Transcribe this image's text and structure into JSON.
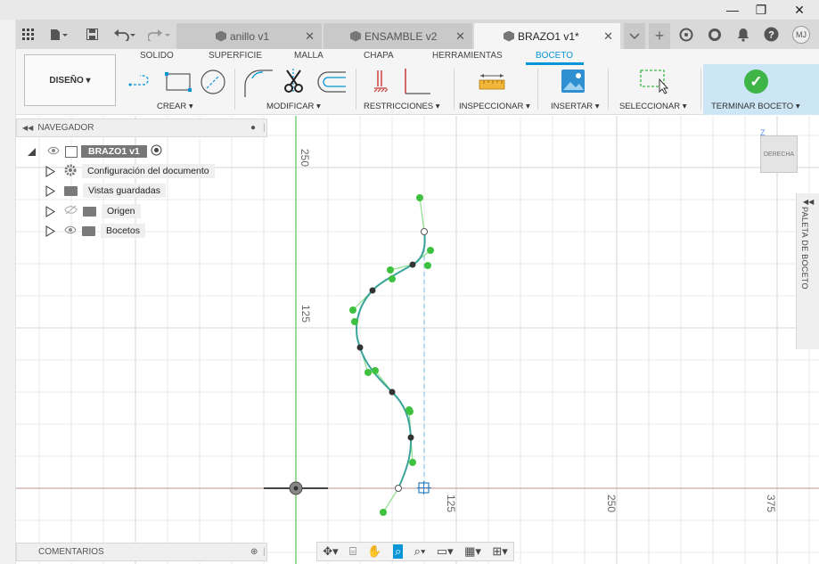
{
  "window": {
    "minimize_glyph": "—",
    "restore_glyph": "❐",
    "close_glyph": "✕"
  },
  "tabs": [
    {
      "label": "anillo v1",
      "active": false
    },
    {
      "label": "ENSAMBLE v2",
      "active": false
    },
    {
      "label": "BRAZO1 v1*",
      "active": true
    }
  ],
  "tab_close_glyph": "✕",
  "user_initials": "MJ",
  "ribbon": {
    "workspace_button": "DISEÑO ▾",
    "tabs": [
      "SOLIDO",
      "SUPERFICIE",
      "MALLA",
      "CHAPA",
      "HERRAMIENTAS",
      "BOCETO"
    ],
    "active_tab": "BOCETO",
    "groups": {
      "create": "CREAR ▾",
      "modify": "MODIFICAR ▾",
      "constraints": "RESTRICCIONES ▾",
      "inspect": "INSPECCIONAR ▾",
      "insert": "INSERTAR ▾",
      "select": "SELECCIONAR ▾",
      "finish": "TERMINAR BOCETO ▾"
    },
    "finish_check_glyph": "✓"
  },
  "browser": {
    "title": "NAVEGADOR",
    "root": "BRAZO1 v1",
    "items": [
      {
        "label": "Configuración del documento"
      },
      {
        "label": "Vistas guardadas"
      },
      {
        "label": "Origen"
      },
      {
        "label": "Bocetos"
      }
    ]
  },
  "comments": {
    "title": "COMENTARIOS"
  },
  "viewcube": {
    "face": "DERECHA",
    "axis_z": "Z"
  },
  "palette": {
    "title": "PALETA DE BOCETO"
  },
  "grid_labels": {
    "v_250": "250",
    "v_125": "125",
    "h_125": "125",
    "h_250": "250",
    "h_375": "375"
  },
  "colors": {
    "accent": "#0696d7",
    "finish_bg": "#cde6f6",
    "finish_check": "#3fb548",
    "spline": "#3aa39a",
    "control_point": "#3ec13e",
    "axis_green": "#7ccd7c",
    "axis_red": "#c9a8a8"
  }
}
